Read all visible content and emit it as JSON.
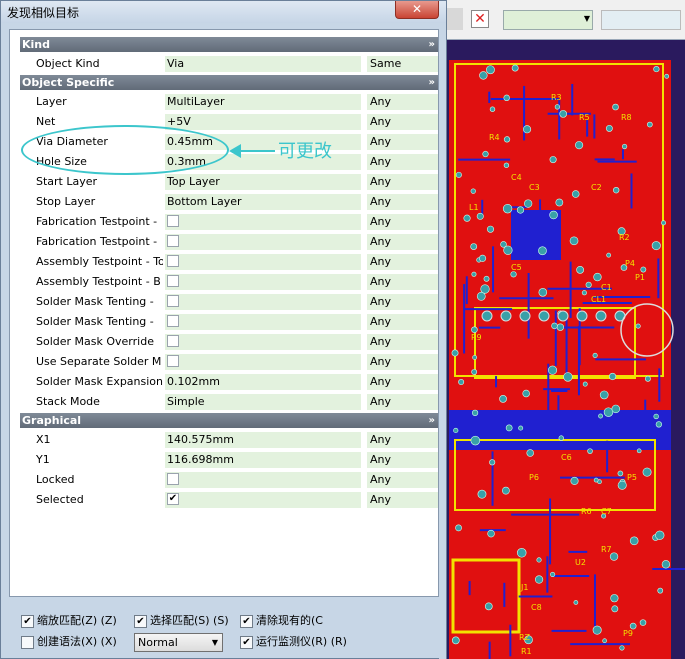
{
  "window": {
    "title": "发现相似目标",
    "close_glyph": "✕"
  },
  "categories": {
    "kind": {
      "label": "Kind",
      "chevron": "»"
    },
    "object_specific": {
      "label": "Object Specific",
      "chevron": "»"
    },
    "graphical": {
      "label": "Graphical",
      "chevron": "»"
    }
  },
  "rows": {
    "object_kind": {
      "label": "Object Kind",
      "value": "Via",
      "compare": "Same"
    },
    "layer": {
      "label": "Layer",
      "value": "MultiLayer",
      "compare": "Any"
    },
    "net": {
      "label": "Net",
      "value": "+5V",
      "compare": "Any"
    },
    "via_diameter": {
      "label": "Via Diameter",
      "value": "0.45mm",
      "compare": "Any"
    },
    "hole_size": {
      "label": "Hole Size",
      "value": "0.3mm",
      "compare": "Any"
    },
    "start_layer": {
      "label": "Start Layer",
      "value": "Top Layer",
      "compare": "Any"
    },
    "stop_layer": {
      "label": "Stop Layer",
      "value": "Bottom Layer",
      "compare": "Any"
    },
    "fab_testpoint_top": {
      "label": "Fabrication Testpoint - ",
      "compare": "Any"
    },
    "fab_testpoint_bottom": {
      "label": "Fabrication Testpoint - ",
      "compare": "Any"
    },
    "assembly_testpoint_top": {
      "label": "Assembly Testpoint - To",
      "compare": "Any"
    },
    "assembly_testpoint_bottom": {
      "label": "Assembly Testpoint - B",
      "compare": "Any"
    },
    "solder_mask_tenting_top": {
      "label": "Solder Mask Tenting - ",
      "compare": "Any"
    },
    "solder_mask_tenting_bottom": {
      "label": "Solder Mask Tenting - ",
      "compare": "Any"
    },
    "solder_mask_override": {
      "label": "Solder Mask Override",
      "compare": "Any"
    },
    "use_separate_solder_mask": {
      "label": "Use Separate Solder M",
      "compare": "Any"
    },
    "solder_mask_expansion": {
      "label": "Solder Mask Expansion",
      "value": "0.102mm",
      "compare": "Any"
    },
    "stack_mode": {
      "label": "Stack Mode",
      "value": "Simple",
      "compare": "Any"
    },
    "x1": {
      "label": "X1",
      "value": "140.575mm",
      "compare": "Any"
    },
    "y1": {
      "label": "Y1",
      "value": "116.698mm",
      "compare": "Any"
    },
    "locked": {
      "label": "Locked",
      "compare": "Any"
    },
    "selected": {
      "label": "Selected",
      "compare": "Any",
      "checked": true,
      "check_glyph": "✔"
    }
  },
  "annotation": {
    "text": "可更改",
    "color": "#3cc6cc"
  },
  "options": {
    "zoom_matching": {
      "label": "缩放匹配(Z) (Z)",
      "checked": true
    },
    "select_matching": {
      "label": "选择匹配(S) (S)",
      "checked": true
    },
    "clear_existing": {
      "label": "清除现有的(C",
      "checked": true
    },
    "create_expression": {
      "label": "创建语法(X) (X)",
      "checked": false
    },
    "run_inspector": {
      "label": "运行监测仪(R) (R)",
      "checked": true
    },
    "mode_select": {
      "value": "Normal"
    },
    "check_glyph": "✔"
  },
  "pcb": {
    "labels": [
      "R3",
      "R5",
      "R4",
      "C4",
      "R8",
      "L1",
      "C3",
      "C2",
      "R2",
      "C5",
      "C1",
      "P4",
      "P1",
      "P5",
      "C6",
      "P6",
      "R6",
      "C7",
      "R7",
      "U2",
      "J1",
      "C8",
      "P9",
      "R1",
      "RZ",
      "R9",
      "CL1"
    ],
    "colors": {
      "board": "#e01010",
      "silk": "#f2e200",
      "trace": "#2020d0",
      "pad": "#39a0a8",
      "bg": "#2a1a5e"
    }
  }
}
